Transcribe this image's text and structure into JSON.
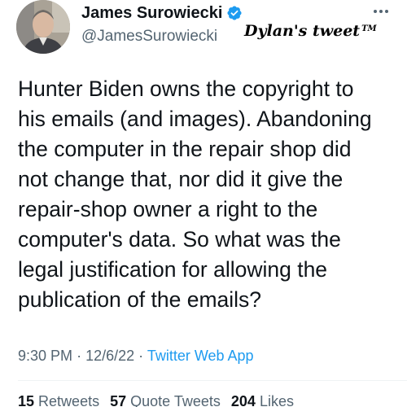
{
  "author": {
    "display_name": "James Surowiecki",
    "handle": "@JamesSurowiecki",
    "verified": true,
    "verified_color": "#1d9bf0"
  },
  "watermark": {
    "text": "Dylan's tweet",
    "mark": "TM"
  },
  "tweet": {
    "lines": [
      "Hunter Biden owns the copyright to",
      "his emails (and images). Abandoning",
      "the computer in the repair shop did",
      "not change that, nor did it give the",
      "repair-shop owner a right to the",
      "computer's data. So what was the",
      "legal justification for allowing the",
      "publication of the emails?"
    ]
  },
  "meta": {
    "time": "9:30 PM",
    "date": "12/6/22",
    "separator": "·",
    "source": "Twitter Web App"
  },
  "stats": {
    "retweets_count": "15",
    "retweets_label": "Retweets",
    "quotes_count": "57",
    "quotes_label": "Quote Tweets",
    "likes_count": "204",
    "likes_label": "Likes"
  },
  "icons": {
    "verified": "verified-badge-icon",
    "more": "more-options-icon"
  },
  "colors": {
    "text_primary": "#0f1419",
    "text_secondary": "#536471",
    "link": "#1d9bf0"
  }
}
